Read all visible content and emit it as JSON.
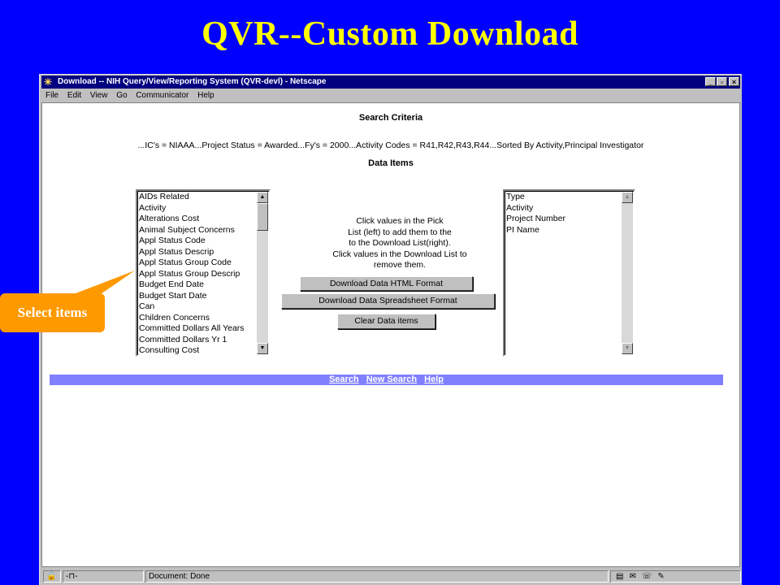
{
  "slide_title": "QVR--Custom Download",
  "window": {
    "title": "Download -- NIH Query/View/Reporting System (QVR-devl) - Netscape",
    "menu": [
      "File",
      "Edit",
      "View",
      "Go",
      "Communicator",
      "Help"
    ]
  },
  "page": {
    "search_criteria_heading": "Search Criteria",
    "criteria_text": "...IC's = NIAAA...Project Status = Awarded...Fy's = 2000...Activity Codes = R41,R42,R43,R44...Sorted By Activity,Principal Investigator",
    "data_items_heading": "Data Items",
    "pick_list": [
      "AIDs Related",
      "Activity",
      "Alterations Cost",
      "Animal Subject Concerns",
      "Appl Status Code",
      "Appl Status Descrip",
      "Appl Status Group Code",
      "Appl Status Group Descrip",
      "Budget End Date",
      "Budget Start Date",
      "Can",
      "Children Concerns",
      "Committed Dollars All Years",
      "Committed Dollars Yr 1",
      "Consulting Cost"
    ],
    "instructions": [
      "Click values in the Pick",
      "List (left) to add them to the",
      "to the Download List(right).",
      "Click values in the Download List to",
      "remove them."
    ],
    "btn_html": "Download Data HTML Format",
    "btn_spreadsheet": "Download Data Spreadsheet Format",
    "btn_clear": "Clear Data items",
    "download_list": [
      "Type",
      "Activity",
      "Project Number",
      "PI Name"
    ],
    "nav_links": [
      "Search",
      "New Search",
      "Help"
    ]
  },
  "status": {
    "text": "Document: Done"
  },
  "callout": {
    "label": "Select items"
  },
  "colors": {
    "slide_background": "#0000ff",
    "title_text": "#ffff00",
    "callout": "#ff9900",
    "title_bar": "#000080",
    "nav_bar": "#8080ff"
  }
}
